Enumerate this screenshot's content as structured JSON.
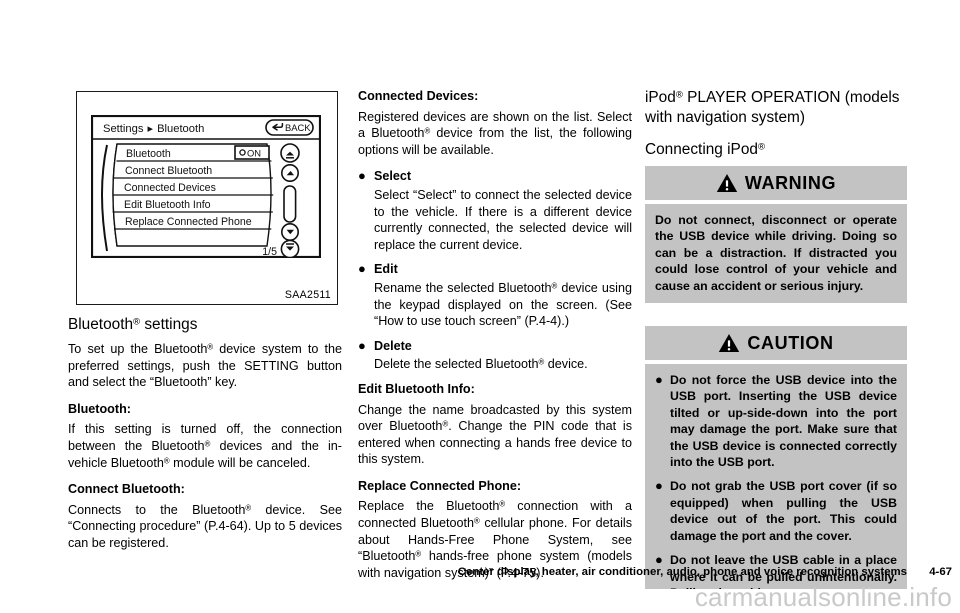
{
  "figure": {
    "caption": "SAA2511",
    "screen": {
      "breadcrumb_root": "Settings",
      "breadcrumb_arrow": "▸",
      "breadcrumb_leaf": "Bluetooth",
      "back_label": "BACK",
      "page_indicator": "1/5",
      "rows": [
        {
          "label": "Bluetooth",
          "toggle": "ON"
        },
        {
          "label": "Connect Bluetooth",
          "toggle": ""
        },
        {
          "label": "Connected Devices",
          "toggle": ""
        },
        {
          "label": "Edit Bluetooth Info",
          "toggle": ""
        },
        {
          "label": "Replace Connected Phone",
          "toggle": ""
        },
        {
          "label": "",
          "toggle": ""
        }
      ],
      "scroll_buttons": [
        "scroll-top",
        "scroll-up",
        "scroll-down",
        "scroll-bottom"
      ]
    }
  },
  "left_column": {
    "title_a": "Bluetooth",
    "title_b": " settings",
    "intro_1": "To set up the Bluetooth",
    "intro_2": " device system to the preferred settings, push the SETTING button and select the “Bluetooth” key.",
    "bluetooth_heading": "Bluetooth:",
    "bluetooth_text_1": "If this setting is turned off, the connection between the Bluetooth",
    "bluetooth_text_2": " devices and the in-vehicle Bluetooth",
    "bluetooth_text_3": " module will be canceled.",
    "connect_heading": "Connect Bluetooth:",
    "connect_text_1": "Connects to the Bluetooth",
    "connect_text_2": " device. See “Connecting procedure” (P.4-64). Up to 5 devices can be registered."
  },
  "mid_column": {
    "connected_devices_heading": "Connected Devices:",
    "connected_devices_text_1": "Registered devices are shown on the list. Select a Bluetooth",
    "connected_devices_text_2": " device from the list, the following options will be available.",
    "bullets": [
      {
        "label": "Select",
        "text": "Select “Select” to connect the selected device to the vehicle. If there is a different device currently connected, the selected device will replace the current device."
      },
      {
        "label": "Edit",
        "text_1": "Rename the selected Bluetooth",
        "text_2": " device using the keypad displayed on the screen. (See “How to use touch screen” (P.4-4).)"
      },
      {
        "label": "Delete",
        "text_1": "Delete the selected Bluetooth",
        "text_2": " device."
      }
    ],
    "edit_info_heading": "Edit Bluetooth Info:",
    "edit_info_text_1": "Change the name broadcasted by this system over Bluetooth",
    "edit_info_text_2": ". Change the PIN code that is entered when connecting a hands free device to this system.",
    "replace_heading": "Replace Connected Phone:",
    "replace_text_1": "Replace the Bluetooth",
    "replace_text_2": " connection with a connected Bluetooth",
    "replace_text_3": " cellular phone. For details about Hands-Free Phone System, see “Bluetooth",
    "replace_text_4": " hands-free phone system (models with navigation system)” (P.4-75)."
  },
  "right_column": {
    "title_1": "iPod",
    "title_2": " PLAYER OPERATION (models with navigation system)",
    "subtitle_1": "Connecting iPod",
    "subtitle_2": "",
    "warning": {
      "label": "WARNING",
      "icon": "warning-triangle-icon",
      "text": "Do not connect, disconnect or operate the USB device while driving. Doing so can be a distraction. If distracted you could lose control of your vehicle and cause an accident or serious injury."
    },
    "caution": {
      "label": "CAUTION",
      "icon": "warning-triangle-icon",
      "items": [
        "Do not force the USB device into the USB port. Inserting the USB device tilted or up-side-down into the port may damage the port. Make sure that the USB device is connected correctly into the USB port.",
        "Do not grab the USB port cover (if so equipped) when pulling the USB device out of the port. This could damage the port and the cover.",
        "Do not leave the USB cable in a place where it can be pulled unintentionally. Pulling the cable may"
      ]
    }
  },
  "footer": {
    "title": "Center display, heater, air conditioner, audio, phone and voice recognition systems",
    "page": "4-67",
    "watermark": "carmanualsonline.info"
  },
  "colors": {
    "callout_gray": "#c3c3c3",
    "ink": "#000000",
    "watermark_gray": "#c9c9c9"
  }
}
